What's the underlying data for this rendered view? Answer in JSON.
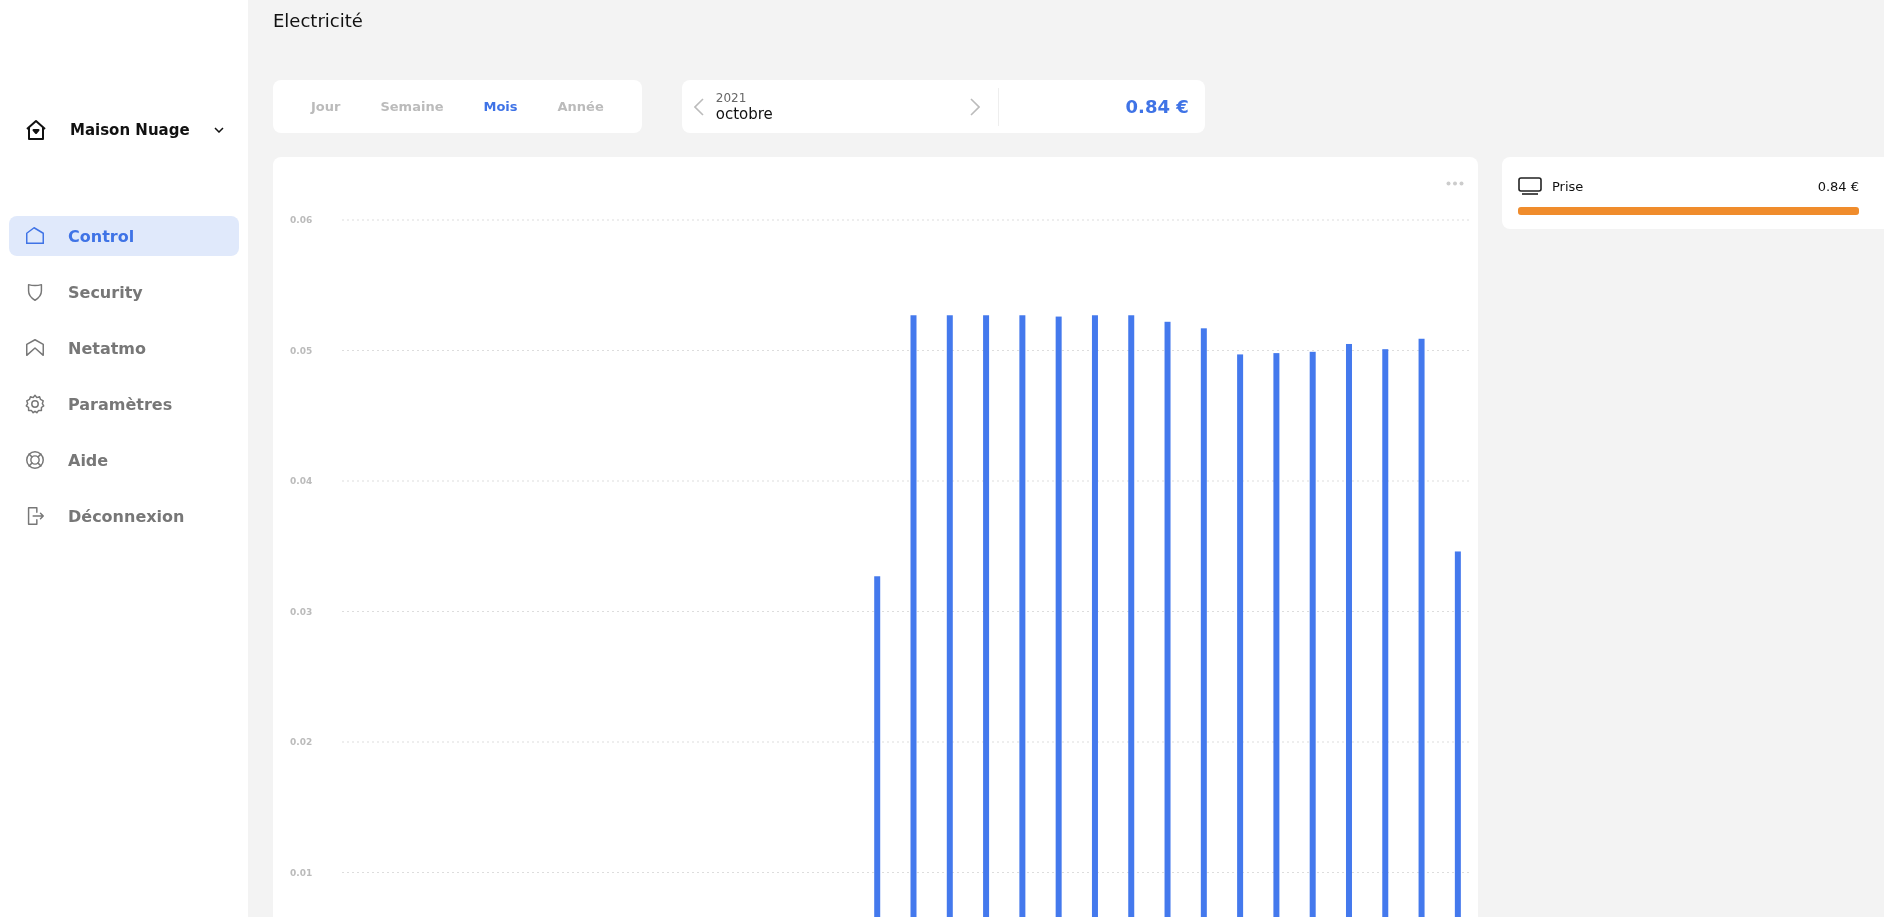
{
  "page_title": "Electricité",
  "home": {
    "name": "Maison Nuage"
  },
  "sidebar": {
    "items": [
      {
        "label": "Control",
        "selected": true
      },
      {
        "label": "Security",
        "selected": false
      },
      {
        "label": "Netatmo",
        "selected": false
      },
      {
        "label": "Paramètres",
        "selected": false
      },
      {
        "label": "Aide",
        "selected": false
      },
      {
        "label": "Déconnexion",
        "selected": false
      }
    ]
  },
  "period_tabs": [
    {
      "label": "Jour",
      "selected": false
    },
    {
      "label": "Semaine",
      "selected": false
    },
    {
      "label": "Mois",
      "selected": true
    },
    {
      "label": "Année",
      "selected": false
    }
  ],
  "date_picker": {
    "year": "2021",
    "month": "octobre",
    "total": "0.84 €"
  },
  "chart": {
    "chart_data": {
      "type": "bar",
      "ylim": [
        0.01,
        0.06
      ],
      "yticks": [
        0.01,
        0.02,
        0.03,
        0.04,
        0.05,
        0.06
      ],
      "grid": true,
      "series": [
        {
          "color": "#4479ed",
          "values": [
            null,
            null,
            null,
            null,
            null,
            null,
            null,
            null,
            null,
            null,
            null,
            null,
            null,
            null,
            0.0327,
            0.0527,
            0.0527,
            0.0527,
            0.0527,
            0.0526,
            0.0527,
            0.0527,
            0.0522,
            0.0517,
            0.0497,
            0.0498,
            0.0499,
            0.0505,
            0.0501,
            0.0509,
            0.0346
          ]
        }
      ]
    }
  },
  "devices": [
    {
      "name": "Prise",
      "value": "0.84 €",
      "level": 1,
      "color": "#f08c2c"
    }
  ]
}
